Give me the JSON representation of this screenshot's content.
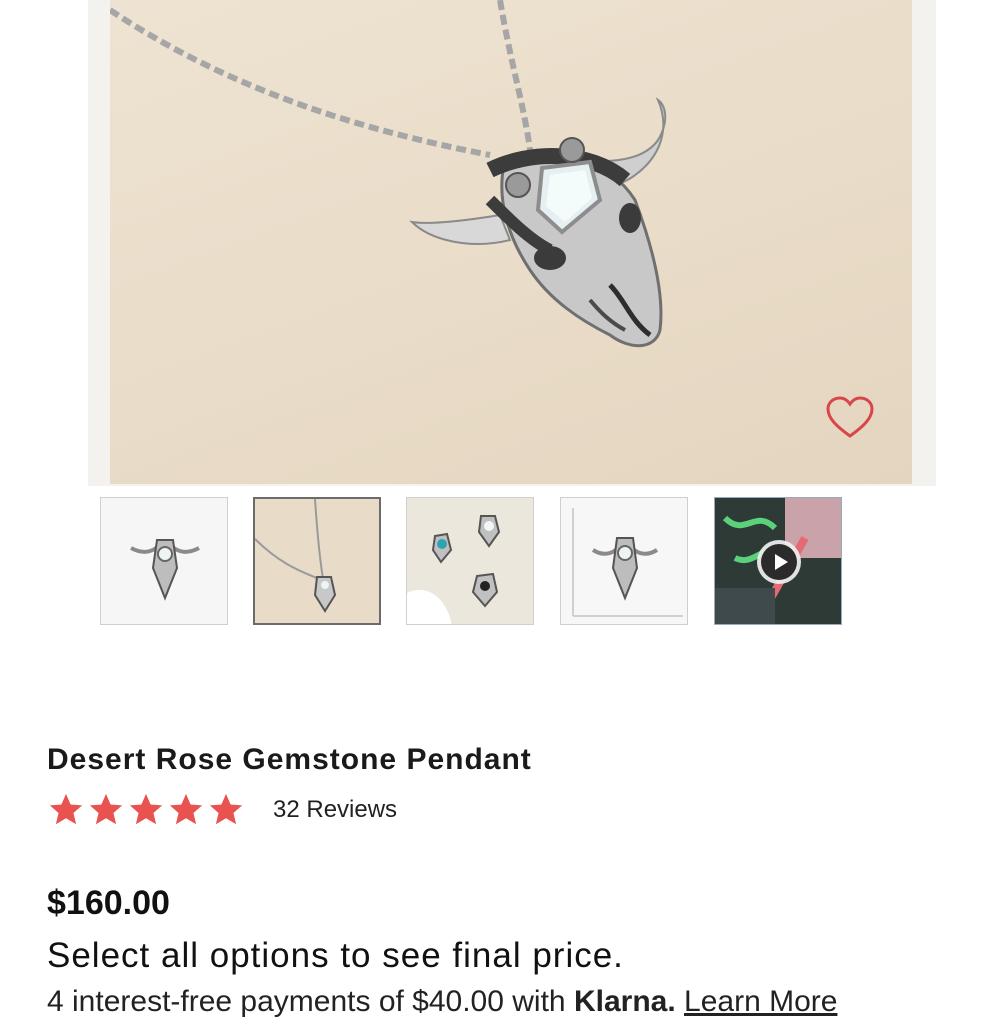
{
  "product": {
    "title": "Desert Rose Gemstone Pendant",
    "rating": 5,
    "reviews_label": "32 Reviews",
    "price": "$160.00",
    "price_note": "Select all options to see final price.",
    "installments_text": "4 interest-free payments of $40.00 with",
    "installments_provider": "Klarna.",
    "installments_link": "Learn More"
  },
  "gallery": {
    "thumbnails": [
      {
        "name": "front view on white"
      },
      {
        "name": "pendant on chain"
      },
      {
        "name": "gemstone variants"
      },
      {
        "name": "size scale"
      },
      {
        "name": "video"
      }
    ],
    "selected_index": 1
  },
  "colors": {
    "star": "#e8534f",
    "heart": "#d9464a",
    "text": "#111111"
  }
}
